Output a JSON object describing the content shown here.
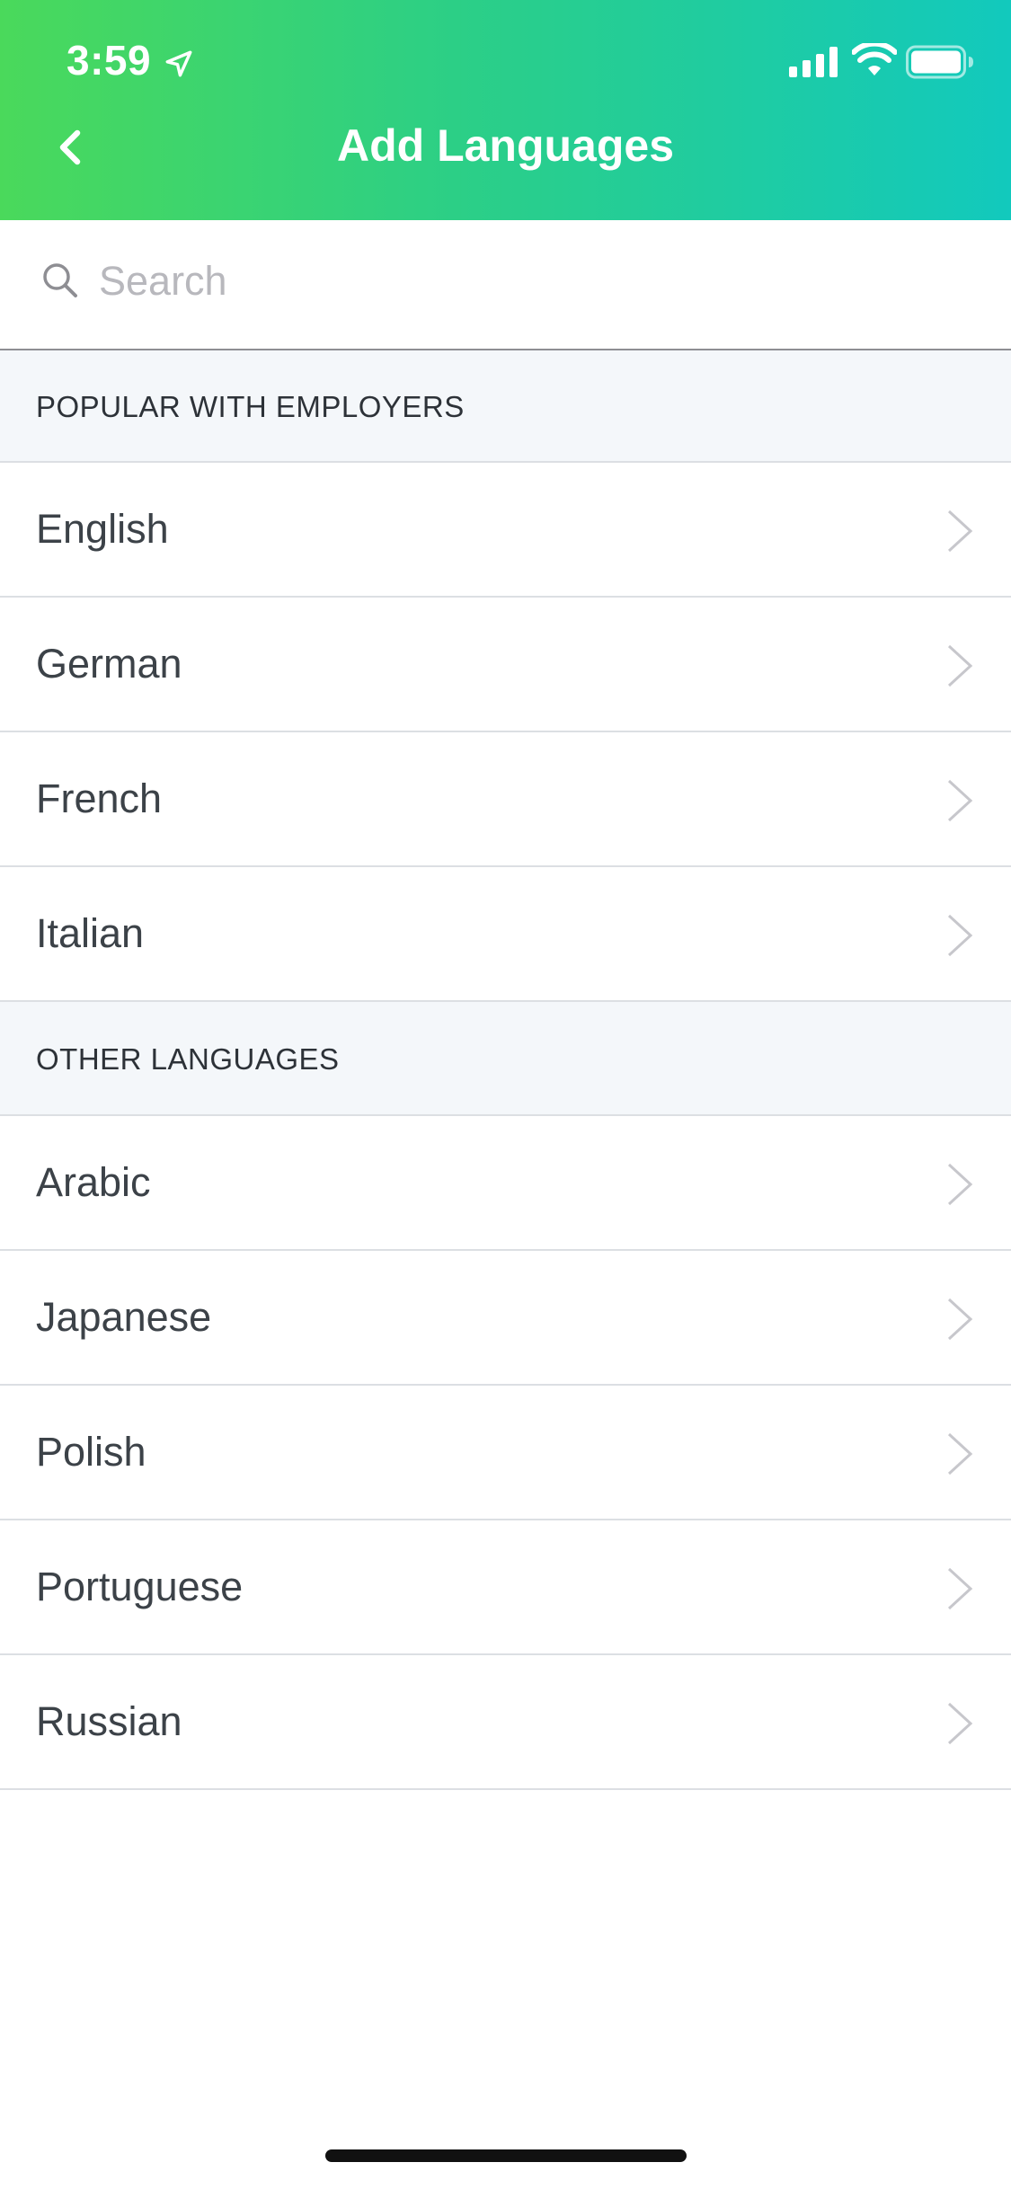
{
  "status_bar": {
    "time": "3:59",
    "location_icon": "location-arrow-icon",
    "signal_icon": "cellular-signal-icon",
    "wifi_icon": "wifi-icon",
    "battery_icon": "battery-icon"
  },
  "header": {
    "title": "Add Languages",
    "back_icon": "chevron-left-icon"
  },
  "search": {
    "placeholder": "Search",
    "value": "",
    "icon": "search-icon"
  },
  "sections": [
    {
      "title": "POPULAR WITH EMPLOYERS",
      "items": [
        "English",
        "German",
        "French",
        "Italian"
      ]
    },
    {
      "title": "OTHER LANGUAGES",
      "items": [
        "Arabic",
        "Japanese",
        "Polish",
        "Portuguese",
        "Russian"
      ]
    }
  ],
  "colors": {
    "gradient_start": "#4ad95b",
    "gradient_end": "#12c9bd",
    "section_background": "#f4f7fa",
    "divider": "#dcdfe3",
    "text_primary": "#3c4248",
    "chevron": "#c7c7cc"
  }
}
